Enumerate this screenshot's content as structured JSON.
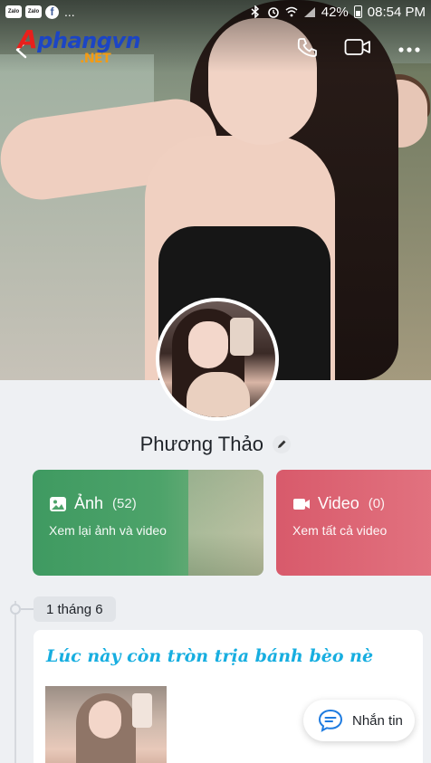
{
  "status_bar": {
    "app_icons": [
      "Zalo",
      "Zalo"
    ],
    "facebook_glyph": "f",
    "more_dots": "...",
    "battery": "42%",
    "time": "08:54 PM"
  },
  "watermark": {
    "text_red": "A",
    "text_blue": "phangvn",
    "text_net": ".NET"
  },
  "profile": {
    "name": "Phương Thảo"
  },
  "media": {
    "photos": {
      "label": "Ảnh",
      "count": "(52)",
      "subtitle": "Xem lại ảnh và video"
    },
    "videos": {
      "label": "Video",
      "count": "(0)",
      "subtitle": "Xem tất cả video"
    }
  },
  "timeline": {
    "date": "1 tháng 6",
    "post_text": "Lúc này còn tròn trịa bánh bèo nè"
  },
  "message_button": {
    "label": "Nhắn tin"
  },
  "colors": {
    "photos_card": "#4da36a",
    "videos_card": "#e27380",
    "post_text": "#17aee0",
    "message_icon": "#1e7be0"
  }
}
